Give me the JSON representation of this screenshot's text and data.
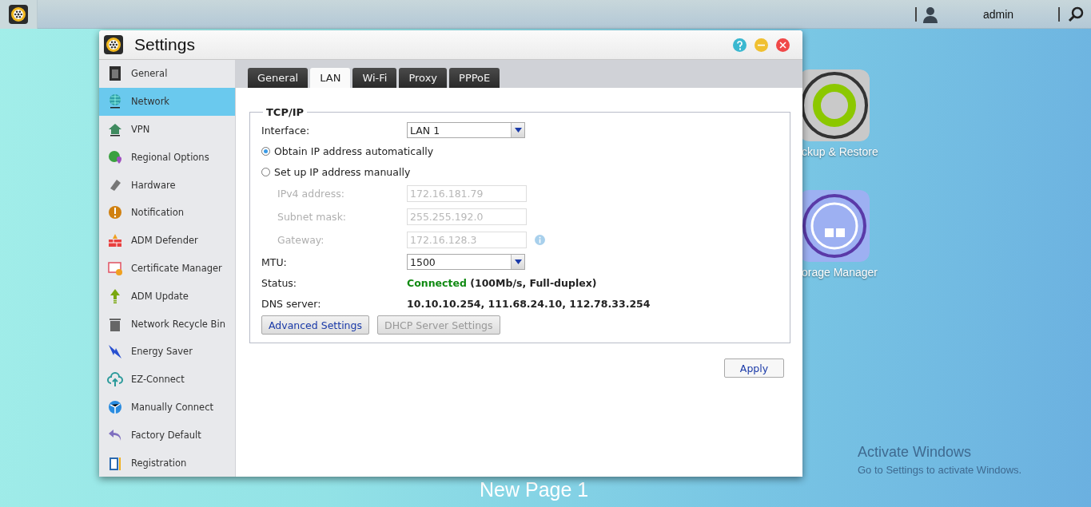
{
  "taskbar": {
    "user": "admin"
  },
  "window": {
    "title": "Settings"
  },
  "sidebar": {
    "items": [
      {
        "label": "General",
        "selected": false
      },
      {
        "label": "Network",
        "selected": true
      },
      {
        "label": "VPN",
        "selected": false
      },
      {
        "label": "Regional Options",
        "selected": false
      },
      {
        "label": "Hardware",
        "selected": false
      },
      {
        "label": "Notification",
        "selected": false
      },
      {
        "label": "ADM Defender",
        "selected": false
      },
      {
        "label": "Certificate Manager",
        "selected": false
      },
      {
        "label": "ADM Update",
        "selected": false
      },
      {
        "label": "Network Recycle Bin",
        "selected": false
      },
      {
        "label": "Energy Saver",
        "selected": false
      },
      {
        "label": "EZ-Connect",
        "selected": false
      },
      {
        "label": "Manually Connect",
        "selected": false
      },
      {
        "label": "Factory Default",
        "selected": false
      },
      {
        "label": "Registration",
        "selected": false
      }
    ]
  },
  "tabs": [
    {
      "label": "General",
      "selected": false
    },
    {
      "label": "LAN",
      "selected": true
    },
    {
      "label": "Wi-Fi",
      "selected": false
    },
    {
      "label": "Proxy",
      "selected": false
    },
    {
      "label": "PPPoE",
      "selected": false
    }
  ],
  "tcpip": {
    "legend": "TCP/IP",
    "interface": {
      "label": "Interface:",
      "value": "LAN 1"
    },
    "ip_modes": [
      {
        "label": "Obtain IP address automatically",
        "selected": true
      },
      {
        "label": "Set up IP address manually",
        "selected": false
      }
    ],
    "manual_fields": [
      {
        "label": "IPv4 address:",
        "value": "172.16.181.79",
        "disabled": true
      },
      {
        "label": "Subnet mask:",
        "value": "255.255.192.0",
        "disabled": true
      },
      {
        "label": "Gateway:",
        "value": "172.16.128.3",
        "disabled": true
      }
    ],
    "mtu": {
      "label": "MTU:",
      "value": "1500"
    },
    "status": {
      "label": "Status:",
      "state": "Connected",
      "detail": "(100Mb/s, Full-duplex)"
    },
    "dns": {
      "label": "DNS server:",
      "value": "10.10.10.254, 111.68.24.10, 112.78.33.254"
    },
    "buttons": [
      {
        "label": "Advanced Settings",
        "disabled": false
      },
      {
        "label": "DHCP Server Settings",
        "disabled": true
      }
    ]
  },
  "apply": "Apply",
  "desktop": {
    "icons": [
      {
        "label": "ckup & Restore"
      },
      {
        "label": "orage Manager"
      }
    ],
    "page_title": "New Page 1"
  },
  "activation": {
    "title": "Activate Windows",
    "subtitle": "Go to Settings to activate Windows."
  }
}
